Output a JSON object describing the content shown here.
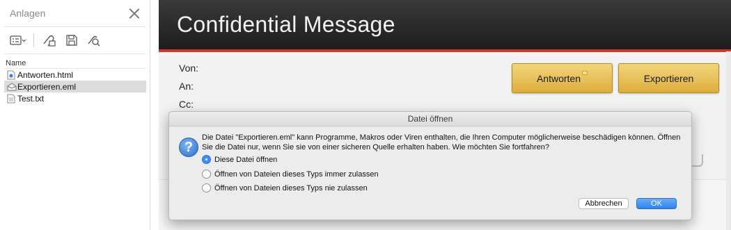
{
  "sidebar": {
    "title": "Anlagen",
    "column_header": "Name",
    "files": [
      {
        "name": "Antworten.html",
        "icon": "html-file-icon",
        "selected": false
      },
      {
        "name": "Exportieren.eml",
        "icon": "email-file-icon",
        "selected": true
      },
      {
        "name": "Test.txt",
        "icon": "text-file-icon",
        "selected": false
      }
    ],
    "toolbar_icons": [
      "list-view-icon",
      "attach-open-icon",
      "save-icon",
      "quick-look-icon"
    ]
  },
  "message": {
    "banner_title": "Confidential Message",
    "labels": {
      "from": "Von:",
      "to": "An:",
      "cc": "Cc:"
    },
    "reply_button": "Antworten",
    "export_button": "Exportieren"
  },
  "dialog": {
    "title": "Datei öffnen",
    "message": "Die Datei \"Exportieren.eml\" kann Programme, Makros oder Viren enthalten, die Ihren Computer möglicherweise beschädigen können. Öffnen Sie die Datei nur, wenn Sie sie von einer sicheren Quelle erhalten haben. Wie möchten Sie fortfahren?",
    "options": [
      {
        "label": "Diese Datei öffnen",
        "selected": true
      },
      {
        "label": "Öffnen von Dateien dieses Typs immer zulassen",
        "selected": false
      },
      {
        "label": "Öffnen von Dateien dieses Typs nie zulassen",
        "selected": false
      }
    ],
    "cancel_button": "Abbrechen",
    "ok_button": "OK"
  },
  "colors": {
    "banner_accent": "#c93a2a",
    "gold_button": "#e8c058",
    "primary_button": "#3f8ef0"
  }
}
